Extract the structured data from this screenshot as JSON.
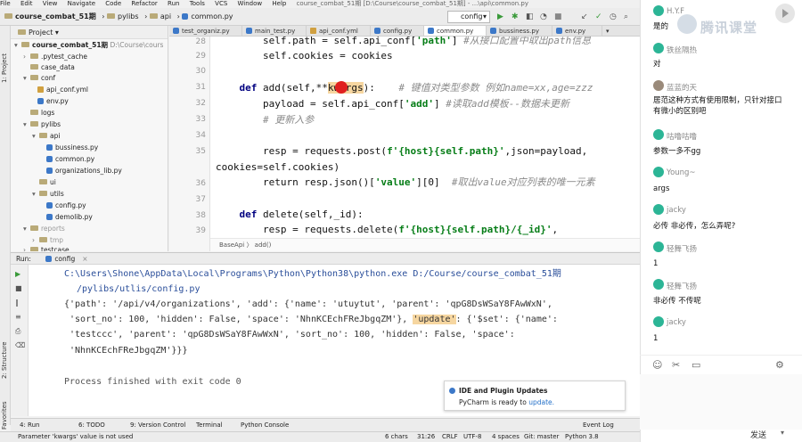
{
  "menu": [
    "File",
    "Edit",
    "View",
    "Navigate",
    "Code",
    "Refactor",
    "Run",
    "Tools",
    "VCS",
    "Window",
    "Help"
  ],
  "title_bar": "course_combat_51期 [D:\\Course\\course_combat_51期] - ...\\api\\common.py",
  "breadcrumb": [
    "course_combat_51期",
    "pylibs",
    "api",
    "common.py"
  ],
  "run_config": "config",
  "project": {
    "header": "Project",
    "tree": [
      {
        "label": "course_combat_51期",
        "suffix": "D:\\Course\\cours",
        "type": "folder",
        "depth": 0
      },
      {
        "label": ".pytest_cache",
        "type": "folder",
        "depth": 1
      },
      {
        "label": "case_data",
        "type": "folder",
        "depth": 1
      },
      {
        "label": "conf",
        "type": "folder",
        "depth": 1
      },
      {
        "label": "api_conf.yml",
        "type": "yml",
        "depth": 2
      },
      {
        "label": "env.py",
        "type": "py",
        "depth": 2
      },
      {
        "label": "logs",
        "type": "folder",
        "depth": 1
      },
      {
        "label": "pylibs",
        "type": "folder",
        "depth": 1
      },
      {
        "label": "api",
        "type": "folder",
        "depth": 2
      },
      {
        "label": "bussiness.py",
        "type": "py",
        "depth": 3
      },
      {
        "label": "common.py",
        "type": "py",
        "depth": 3
      },
      {
        "label": "organizations_lib.py",
        "type": "py",
        "depth": 3
      },
      {
        "label": "ui",
        "type": "folder",
        "depth": 2
      },
      {
        "label": "utils",
        "type": "folder",
        "depth": 2
      },
      {
        "label": "config.py",
        "type": "py",
        "depth": 3
      },
      {
        "label": "demolib.py",
        "type": "py",
        "depth": 3
      },
      {
        "label": "reports",
        "type": "folder",
        "depth": 1
      },
      {
        "label": "tmp",
        "type": "folder",
        "depth": 2
      },
      {
        "label": "testcase",
        "type": "folder",
        "depth": 1
      }
    ]
  },
  "tabs": [
    "test_organiz.py",
    "main_test.py",
    "api_conf.yml",
    "config.py",
    "common.py",
    "bussiness.py",
    "env.py"
  ],
  "editor": {
    "line_numbers": [
      "28",
      "29",
      "30",
      "31",
      "32",
      "33",
      "34",
      "35",
      "",
      "36",
      "37",
      "38",
      "39"
    ],
    "lines": {
      "l28a": "        self.path = self.api_conf[",
      "l28b": "'path'",
      "l28c": "] ",
      "l28d": "#从接口配置中取出path信息",
      "l29": "        self.cookies = cookies",
      "l31a": "    def ",
      "l31b": "add",
      "l31c": "(self,**",
      "l31d": "kwargs",
      "l31e": "):    ",
      "l31f": "# 键值对类型参数 例如name=xx,age=zzz",
      "l32a": "        payload = self.api_conf[",
      "l32b": "'add'",
      "l32c": "] ",
      "l32d": "#读取add模板--数据未更新",
      "l33": "        # 更新入参",
      "l35a": "        resp = requests.post(",
      "l35b": "f'{host}{self.path}'",
      "l35c": ",json=payload,",
      "l35d": "cookies=self.cookies)",
      "l36a": "        return resp.json()[",
      "l36b": "'value'",
      "l36c": "][0]  ",
      "l36d": "#取出value对应列表的唯一元素",
      "l38a": "    def ",
      "l38b": "delete",
      "l38c": "(self,_id):",
      "l39a": "        resp = requests.delete(",
      "l39b": "f'{host}{self.path}/{_id}'",
      "l39c": ","
    },
    "crumb": "BaseApi  〉 add()"
  },
  "run": {
    "label": "Run:",
    "config": "config",
    "command_a": "C:\\Users\\Shone\\AppData\\Local\\Programs\\Python\\Python38\\python.exe D:/Course/course_combat_51期",
    "command_b": "/pylibs/utlis/config.py",
    "out1a": "{'path': '/api/v4/organizations', 'add': {'name': 'utuytut', 'parent': 'qpG8DsWSaY8FAwWxN',",
    "out2a": " 'sort_no': 100, 'hidden': False, 'space': 'NhnKCEchFReJbgqZM'}, ",
    "out2b": "'update'",
    "out2c": ": {'$set': {'name':",
    "out3": " 'testccc', 'parent': 'qpG8DsWSaY8FAwWxN', 'sort_no': 100, 'hidden': False, 'space':",
    "out4": " 'NhnKCEchFReJbgqZM'}}}",
    "exit": "Process finished with exit code 0"
  },
  "notification": {
    "title": "IDE and Plugin Updates",
    "body": "PyCharm is ready to ",
    "link": "update."
  },
  "bottom_tools": {
    "run": "4: Run",
    "todo": "6: TODO",
    "version_control": "9: Version Control",
    "terminal": "Terminal",
    "python_console": "Python Console",
    "event_log": "Event Log"
  },
  "status": {
    "message": "Parameter 'kwargs' value is not used",
    "chars": "6 chars",
    "position": "31:26",
    "line_sep": "CRLF",
    "encoding": "UTF-8",
    "indent": "4 spaces",
    "git": "Git: master",
    "python": "Python 3.8"
  },
  "side_labels": {
    "project": "1: Project",
    "structure": "2: Structure",
    "favorites": "2: Favorites"
  },
  "chat": {
    "logo": "腾讯课堂",
    "messages": [
      {
        "name": "H.Y.F",
        "text": "是的"
      },
      {
        "name": "铁丝隔热",
        "text": "对"
      },
      {
        "name": "蓝蓝的天",
        "text": "居范这种方式有使用限制，只针对接口有微小的区别吧"
      },
      {
        "name": "咕噜咕噜",
        "text": "参数一多不gg"
      },
      {
        "name": "Young~",
        "text": "args"
      },
      {
        "name": "jacky",
        "text": "必传 非必传，怎么弄呢?"
      },
      {
        "name": "轻舞飞扬",
        "text": "1"
      },
      {
        "name": "轻舞飞扬",
        "text": "非必传 不传呢"
      },
      {
        "name": "jacky",
        "text": "1"
      }
    ],
    "send": "发送"
  }
}
